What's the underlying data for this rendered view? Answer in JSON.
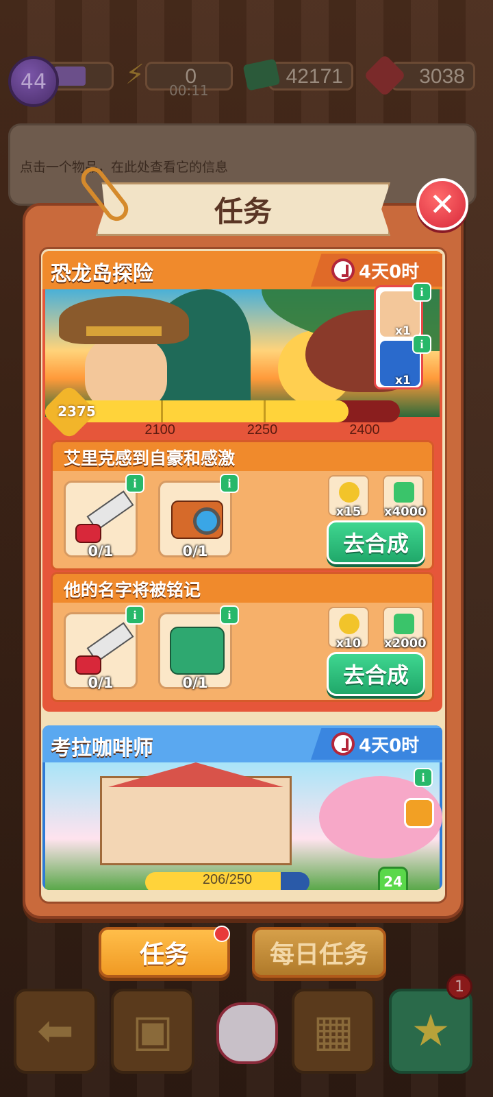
{
  "topbar": {
    "level": "44",
    "energy": "0",
    "energy_timer": "00:11",
    "cash": "42171",
    "gems": "3038"
  },
  "infobar": {
    "text": "点击一个物品，在此处查看它的信息"
  },
  "modal": {
    "title": "任务",
    "close_icon": "close-icon"
  },
  "quest1": {
    "title": "恐龙岛探险",
    "timer": "4天0时",
    "rewards": [
      {
        "icon": "explorer-icon",
        "qty": "x1"
      },
      {
        "icon": "treasure-chest-icon",
        "qty": "x1"
      }
    ],
    "progress": {
      "current": "2375",
      "current_value": 2375,
      "min": 1950,
      "max": 2450,
      "milestones": [
        "2100",
        "2250",
        "2400"
      ]
    },
    "tasks": [
      {
        "title": "艾里克感到自豪和感激",
        "items": [
          {
            "icon": "saw-icon",
            "count": "0/1"
          },
          {
            "icon": "camera-icon",
            "count": "0/1"
          }
        ],
        "rewards": [
          {
            "icon": "coin-icon",
            "amount": "x15"
          },
          {
            "icon": "cash-icon",
            "amount": "x4000"
          }
        ],
        "button": "去合成"
      },
      {
        "title": "他的名字将被铭记",
        "items": [
          {
            "icon": "saw-icon",
            "count": "0/1"
          },
          {
            "icon": "toolbox-icon",
            "count": "0/1"
          }
        ],
        "rewards": [
          {
            "icon": "coin-icon",
            "amount": "x10"
          },
          {
            "icon": "cash-icon",
            "amount": "x2000"
          }
        ],
        "button": "去合成"
      }
    ]
  },
  "quest2": {
    "title": "考拉咖啡师",
    "timer": "4天0时",
    "progress": "206/250",
    "progress_value": 0.824,
    "level": "24"
  },
  "tabs": {
    "active": "任务",
    "daily": "每日任务"
  },
  "bottom_nav": {
    "notification_count": "1"
  }
}
